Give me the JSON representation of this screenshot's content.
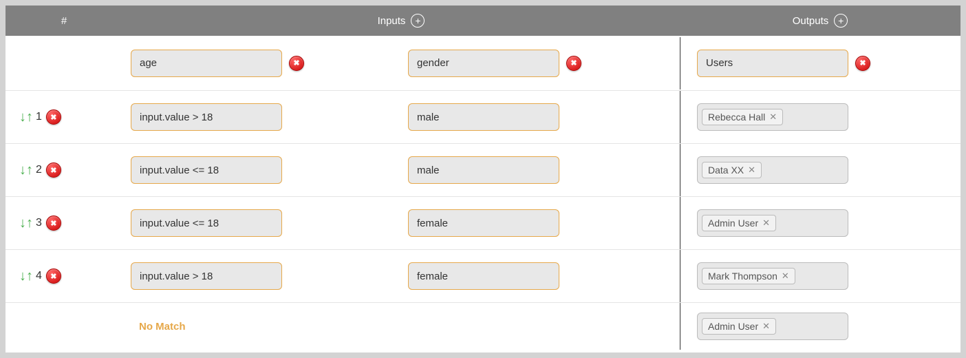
{
  "header": {
    "index_label": "#",
    "inputs_label": "Inputs",
    "outputs_label": "Outputs"
  },
  "columns": {
    "input_a": "age",
    "input_b": "gender",
    "output": "Users"
  },
  "rows": [
    {
      "num": "1",
      "input_a": "input.value > 18",
      "input_b": "male",
      "output_tag": "Rebecca Hall"
    },
    {
      "num": "2",
      "input_a": "input.value <= 18",
      "input_b": "male",
      "output_tag": "Data XX"
    },
    {
      "num": "3",
      "input_a": "input.value <= 18",
      "input_b": "female",
      "output_tag": "Admin User"
    },
    {
      "num": "4",
      "input_a": "input.value > 18",
      "input_b": "female",
      "output_tag": "Mark Thompson"
    }
  ],
  "footer": {
    "no_match_label": "No Match",
    "output_tag": "Admin User"
  }
}
